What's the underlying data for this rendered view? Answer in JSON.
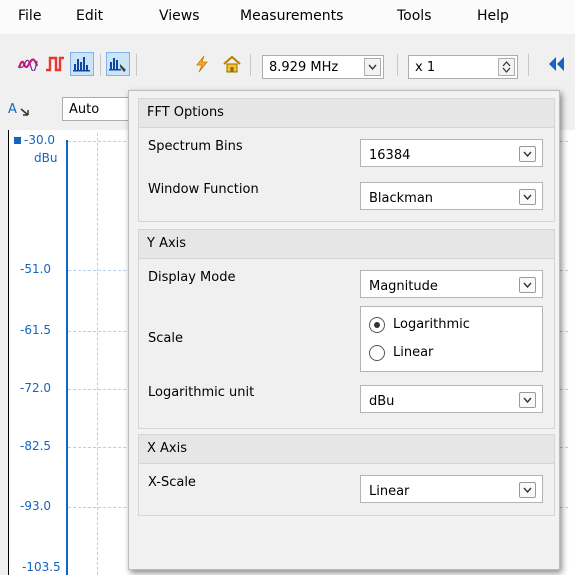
{
  "menu": [
    {
      "label": "File"
    },
    {
      "label": "Edit"
    },
    {
      "label": "Views"
    },
    {
      "label": "Measurements"
    },
    {
      "label": "Tools"
    },
    {
      "label": "Help"
    }
  ],
  "toolbar": {
    "icons": [
      "waveform-icon",
      "square-wave-icon",
      "spectrum-icon",
      "spectrum-settings-icon",
      "lightning-icon",
      "home-icon"
    ],
    "frequency": "8.929 MHz",
    "zoom": "x 1"
  },
  "subbar": {
    "channel": "A",
    "mode": "Auto"
  },
  "plot": {
    "unit": "dBu",
    "y_ticks": [
      "-30.0",
      "-51.0",
      "-61.5",
      "-72.0",
      "-82.5",
      "-93.0",
      "-103.5"
    ]
  },
  "fft_panel": {
    "fft_options": {
      "title": "FFT Options",
      "spectrum_bins_label": "Spectrum Bins",
      "spectrum_bins_value": "16384",
      "window_function_label": "Window Function",
      "window_function_value": "Blackman"
    },
    "y_axis": {
      "title": "Y Axis",
      "display_mode_label": "Display Mode",
      "display_mode_value": "Magnitude",
      "scale_label": "Scale",
      "scale_options": [
        "Logarithmic",
        "Linear"
      ],
      "scale_selected": "Logarithmic",
      "log_unit_label": "Logarithmic unit",
      "log_unit_value": "dBu"
    },
    "x_axis": {
      "title": "X Axis",
      "x_scale_label": "X-Scale",
      "x_scale_value": "Linear"
    }
  },
  "colors": {
    "accent": "#1565c0",
    "active_button": "#cce4f7"
  }
}
